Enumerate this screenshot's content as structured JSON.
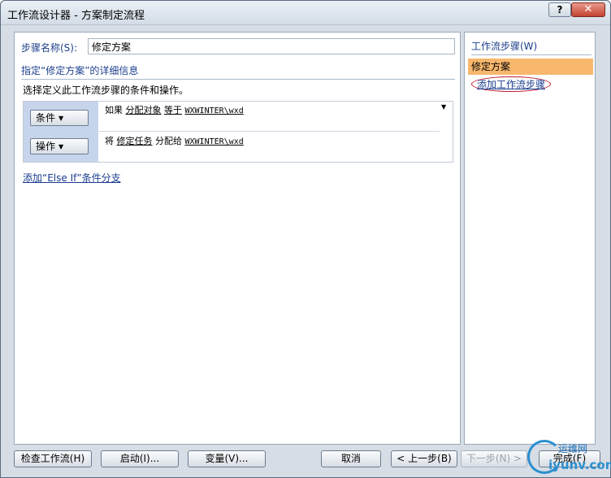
{
  "window": {
    "title": "工作流设计器 - 方案制定流程",
    "help_label": "?",
    "close_label": "✕"
  },
  "step": {
    "name_label": "步骤名称(S):",
    "name_value": "修定方案"
  },
  "details": {
    "section_title": "指定“修定方案”的详细信息",
    "instruction": "选择定义此工作流步骤的条件和操作。",
    "condition_button": "条件",
    "action_button": "操作",
    "condition": {
      "prefix": "如果",
      "field": "分配对象",
      "operator": "等于",
      "value": "WXWINTER\\wxd"
    },
    "action": {
      "prefix": "将",
      "field": "修定任务",
      "verb": "分配给",
      "value": "WXWINTER\\wxd"
    },
    "add_else_if": "添加“Else If”条件分支"
  },
  "sidebar": {
    "title": "工作流步骤(W)",
    "selected_step": "修定方案",
    "add_step": "添加工作流步骤"
  },
  "footer": {
    "check": "检查工作流(H)",
    "initiation": "启动(I)...",
    "variables": "变量(V)...",
    "cancel": "取消",
    "back": "< 上一步(B)",
    "next": "下一步(N) >",
    "finish": "完成(F)"
  },
  "watermark": {
    "top": "运维网",
    "bottom": "iyunv.com"
  },
  "colors": {
    "accent": "#1c3f8c",
    "selected_step": "#f7b76d",
    "rule_panel": "#c6d4ec",
    "highlight_ellipse": "#c0182b"
  }
}
